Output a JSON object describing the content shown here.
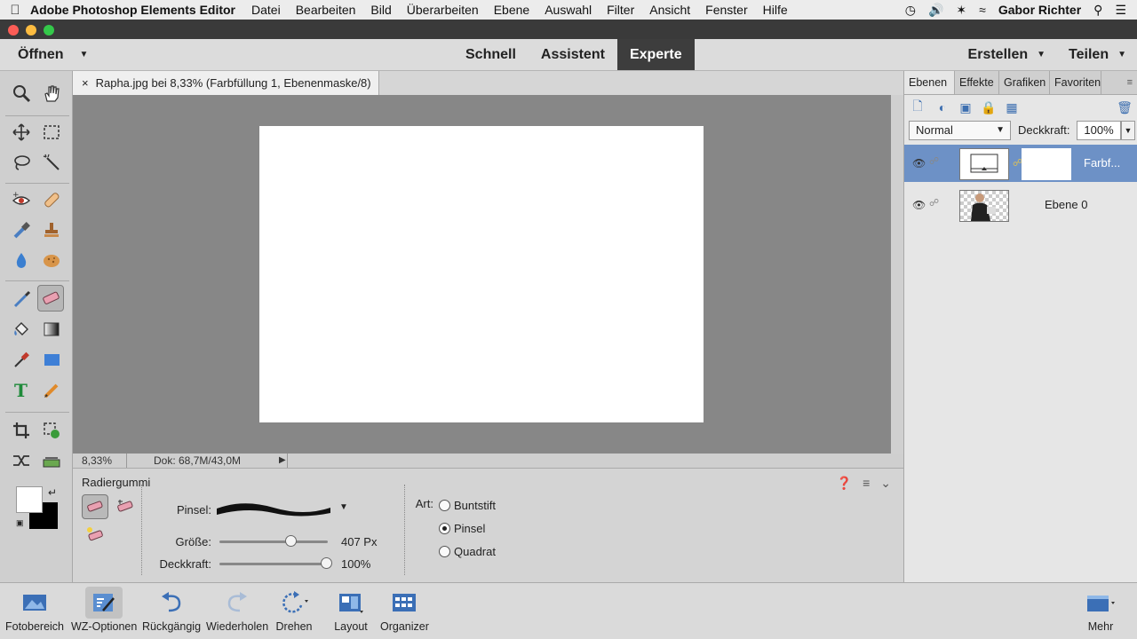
{
  "menubar": {
    "app_name": "Adobe Photoshop Elements Editor",
    "items": [
      "Datei",
      "Bearbeiten",
      "Bild",
      "Überarbeiten",
      "Ebene",
      "Auswahl",
      "Filter",
      "Ansicht",
      "Fenster",
      "Hilfe"
    ],
    "user": "Gabor Richter"
  },
  "topbar": {
    "open_label": "Öffnen",
    "modes": [
      "Schnell",
      "Assistent",
      "Experte"
    ],
    "active_mode": "Experte",
    "create_label": "Erstellen",
    "share_label": "Teilen"
  },
  "document": {
    "tab_title": "Rapha.jpg bei 8,33% (Farbfüllung 1, Ebenenmaske/8) *",
    "zoom": "8,33%",
    "doc_info": "Dok: 68,7M/43,0M"
  },
  "tool_options": {
    "tool_name": "Radiergummi",
    "brush_label": "Pinsel:",
    "size_label": "Größe:",
    "size_value": "407 Px",
    "size_fraction": 0.66,
    "opacity_label": "Deckkraft:",
    "opacity_value": "100%",
    "opacity_fraction": 1.0,
    "type_label": "Art:",
    "types": [
      {
        "label": "Buntstift",
        "selected": false
      },
      {
        "label": "Pinsel",
        "selected": true
      },
      {
        "label": "Quadrat",
        "selected": false
      }
    ]
  },
  "panel": {
    "tabs": [
      "Ebenen",
      "Effekte",
      "Grafiken",
      "Favoriten"
    ],
    "active_tab": "Ebenen",
    "blend_mode": "Normal",
    "opacity_label": "Deckkraft:",
    "opacity_value": "100%",
    "layers": [
      {
        "name": "Farbf...",
        "selected": true
      },
      {
        "name": "Ebene 0",
        "selected": false
      }
    ]
  },
  "bottombar": {
    "items": [
      "Fotobereich",
      "WZ-Optionen",
      "Rückgängig",
      "Wiederholen",
      "Drehen",
      "Layout",
      "Organizer"
    ],
    "more_label": "Mehr"
  },
  "colors": {
    "active_mode_bg": "#3d3d3d",
    "selected_layer": "#6d91c6",
    "canvas_bg": "#878787"
  }
}
